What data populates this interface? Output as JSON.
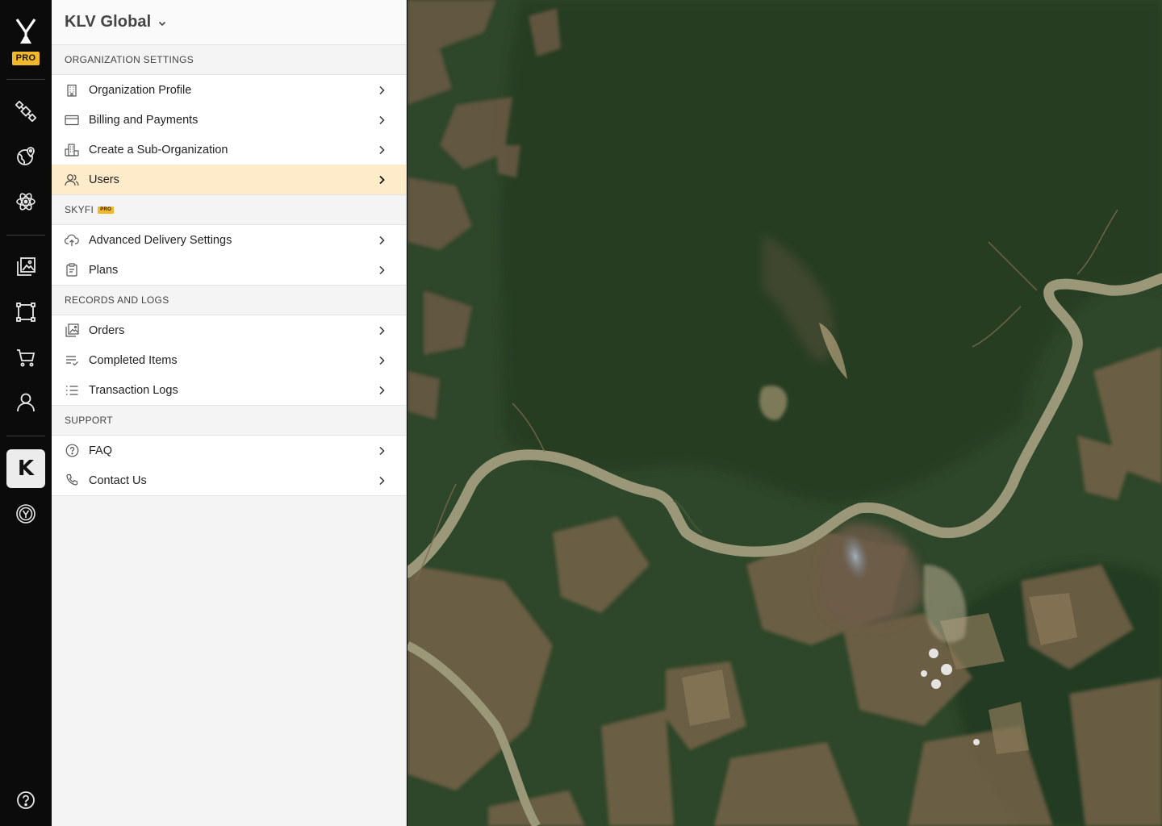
{
  "rail": {
    "badge": "PRO",
    "selected_org_initial": "K",
    "icons": [
      "satellite-icon",
      "globe-location-icon",
      "atom-icon",
      "image-gallery-icon",
      "area-select-icon",
      "cart-icon",
      "user-icon",
      "org-k-icon",
      "skyfi-coin-icon",
      "help-icon"
    ]
  },
  "panel": {
    "org_name": "KLV Global",
    "sections": [
      {
        "title": "ORGANIZATION SETTINGS",
        "items": [
          {
            "label": "Organization Profile",
            "icon": "building-icon"
          },
          {
            "label": "Billing and Payments",
            "icon": "credit-card-icon"
          },
          {
            "label": "Create a Sub-Organization",
            "icon": "buildings-icon"
          },
          {
            "label": "Users",
            "icon": "users-icon",
            "selected": true
          }
        ]
      },
      {
        "title": "SKYFI",
        "badge": "PRO",
        "items": [
          {
            "label": "Advanced Delivery Settings",
            "icon": "cloud-upload-icon"
          },
          {
            "label": "Plans",
            "icon": "clipboard-icon"
          }
        ]
      },
      {
        "title": "RECORDS AND LOGS",
        "items": [
          {
            "label": "Orders",
            "icon": "images-icon"
          },
          {
            "label": "Completed Items",
            "icon": "list-check-icon"
          },
          {
            "label": "Transaction Logs",
            "icon": "list-icon"
          }
        ]
      },
      {
        "title": "SUPPORT",
        "items": [
          {
            "label": "FAQ",
            "icon": "question-circle-icon"
          },
          {
            "label": "Contact Us",
            "icon": "phone-icon"
          }
        ]
      }
    ]
  },
  "colors": {
    "accent": "#f3b72a",
    "selected_row": "#fdebca",
    "rail_bg": "#0b0b0b",
    "forest": "#2d4428",
    "river": "#9c9a7a"
  }
}
